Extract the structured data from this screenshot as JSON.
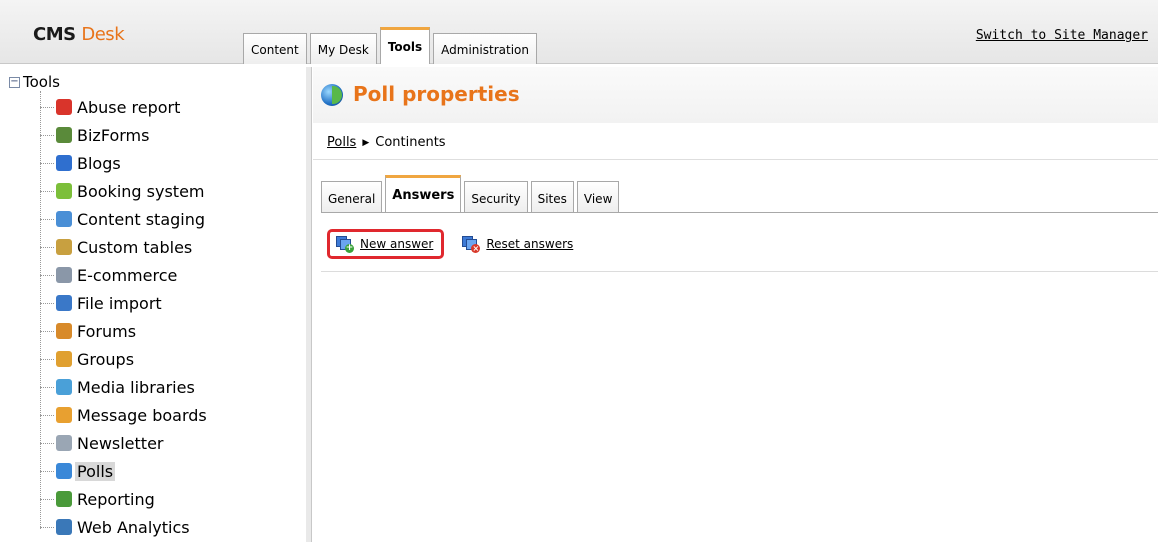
{
  "header": {
    "logo_part1": "CMS",
    "logo_part2": "Desk",
    "tabs": [
      {
        "label": "Content",
        "active": false
      },
      {
        "label": "My Desk",
        "active": false
      },
      {
        "label": "Tools",
        "active": true
      },
      {
        "label": "Administration",
        "active": false
      }
    ],
    "switch_link": "Switch to Site Manager"
  },
  "sidebar": {
    "root_label": "Tools",
    "items": [
      {
        "label": "Abuse report",
        "icon": "abuse-report-icon",
        "color": "#d9342b"
      },
      {
        "label": "BizForms",
        "icon": "bizforms-icon",
        "color": "#5a8a3a"
      },
      {
        "label": "Blogs",
        "icon": "blogs-icon",
        "color": "#2f6fcf"
      },
      {
        "label": "Booking system",
        "icon": "booking-system-icon",
        "color": "#7cbf3a"
      },
      {
        "label": "Content staging",
        "icon": "content-staging-icon",
        "color": "#4a8fd6"
      },
      {
        "label": "Custom tables",
        "icon": "custom-tables-icon",
        "color": "#c8a040"
      },
      {
        "label": "E-commerce",
        "icon": "ecommerce-icon",
        "color": "#8a97a8"
      },
      {
        "label": "File import",
        "icon": "file-import-icon",
        "color": "#3a78c8"
      },
      {
        "label": "Forums",
        "icon": "forums-icon",
        "color": "#d88a2a"
      },
      {
        "label": "Groups",
        "icon": "groups-icon",
        "color": "#e0a030"
      },
      {
        "label": "Media libraries",
        "icon": "media-libraries-icon",
        "color": "#4aa0d8"
      },
      {
        "label": "Message boards",
        "icon": "message-boards-icon",
        "color": "#e8a030"
      },
      {
        "label": "Newsletter",
        "icon": "newsletter-icon",
        "color": "#9aa6b4"
      },
      {
        "label": "Polls",
        "icon": "polls-icon",
        "color": "#3a88d8",
        "selected": true
      },
      {
        "label": "Reporting",
        "icon": "reporting-icon",
        "color": "#4a9a3a"
      },
      {
        "label": "Web Analytics",
        "icon": "web-analytics-icon",
        "color": "#3a78b8"
      }
    ]
  },
  "main": {
    "title": "Poll properties",
    "breadcrumb": {
      "link": "Polls",
      "current": "Continents"
    },
    "tabs": [
      {
        "label": "General",
        "active": false
      },
      {
        "label": "Answers",
        "active": true
      },
      {
        "label": "Security",
        "active": false
      },
      {
        "label": "Sites",
        "active": false
      },
      {
        "label": "View",
        "active": false
      }
    ],
    "actions": {
      "new_answer": "New answer",
      "reset_answers": "Reset answers"
    }
  },
  "colors": {
    "title_orange": "#e8741a",
    "active_tab_accent": "#f0a640",
    "highlight_red": "#e0282e"
  }
}
